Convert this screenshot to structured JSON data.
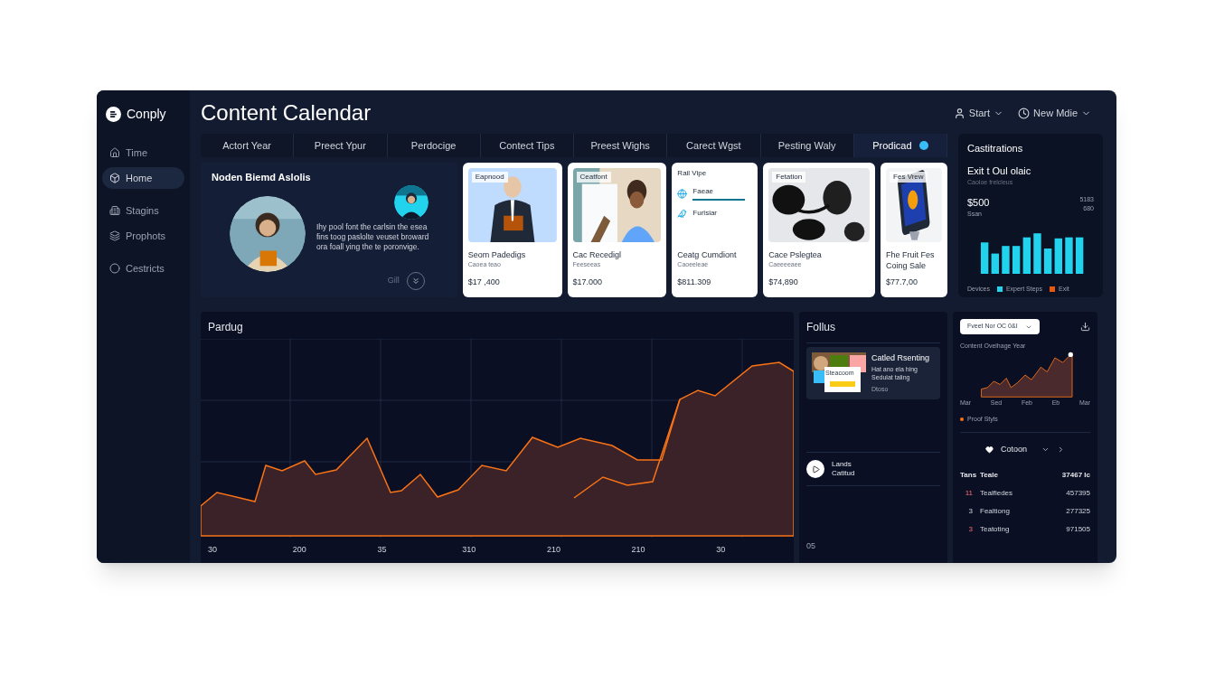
{
  "brand": {
    "name": "Conply"
  },
  "sidebar": {
    "items": [
      {
        "label": "Time",
        "selected": false
      },
      {
        "label": "Home",
        "selected": true
      },
      {
        "label": "Stagins",
        "selected": false
      },
      {
        "label": "Prophots",
        "selected": false
      },
      {
        "label": "Cestricts",
        "selected": false
      }
    ]
  },
  "header": {
    "title": "Content Calendar",
    "actions": [
      {
        "label": "Start"
      },
      {
        "label": "New Mdie"
      }
    ]
  },
  "tabs": [
    {
      "label": "Actort Year",
      "selected": false,
      "dot": false
    },
    {
      "label": "Preect Ypur",
      "selected": false,
      "dot": false
    },
    {
      "label": "Perdocige",
      "selected": false,
      "dot": false
    },
    {
      "label": "Contect Tips",
      "selected": false,
      "dot": false
    },
    {
      "label": "Preest Wighs",
      "selected": false,
      "dot": false
    },
    {
      "label": "Carect Wgst",
      "selected": false,
      "dot": false
    },
    {
      "label": "Pesting Waly",
      "selected": false,
      "dot": false
    },
    {
      "label": "Prodicad",
      "selected": true,
      "dot": true
    }
  ],
  "feature": {
    "title": "Noden Biemd Aslolis",
    "text": "Ihy pool font the carlsin the esea fins toog paslolte veuset broward ora foall ying the te poronvige.",
    "footer": "Gill"
  },
  "cards": [
    {
      "kind": "picture",
      "tag": "Eapnood",
      "title": "Seom Padedigs",
      "subtitle": "Caoea teao",
      "price": "$17 ,400"
    },
    {
      "kind": "picture",
      "tag": "Ceatfont",
      "title": "Cac Recedigl",
      "subtitle": "Feeseeas",
      "price": "$17.000"
    },
    {
      "kind": "list",
      "tag": "Rail Vipe",
      "items": [
        {
          "label": "Faeae"
        },
        {
          "label": "Furlsiar"
        }
      ],
      "title": "Ceatg Cumdiont",
      "subtitle": "Caoeeleae",
      "price": "$811.309"
    },
    {
      "kind": "picture",
      "tag": "Fetation",
      "title": "Cace Pslegtea",
      "subtitle": "Caeeeeaee",
      "price": "$74,890"
    },
    {
      "kind": "picture",
      "tag": "Fes Vrew",
      "title": "Fhe Fruit Fes Coing Sale",
      "price": "$77.7,00"
    }
  ],
  "stats": {
    "heading": "Castitrations",
    "title": "Exit t Oul olaic",
    "subtitle": "Caoloe frelcleus",
    "value": "$500",
    "value_note": "Ssan",
    "side_value": "5183",
    "side_note": "680",
    "legend": [
      {
        "label": "Devices"
      },
      {
        "label": "Expert Steps",
        "color": "#22d3ee"
      },
      {
        "label": "Exit",
        "color": "#ea580c"
      }
    ]
  },
  "trend": {
    "title": "Pardug",
    "x_labels": [
      "30",
      "200",
      "35",
      "310",
      "210",
      "210",
      "30"
    ]
  },
  "follow": {
    "title": "Follus",
    "post": {
      "title": "Catled Rsenting",
      "lines": "Hat ano ela hing Sedulat taling",
      "meta": "Dtoso",
      "badge": "Steacoom"
    },
    "play_label": "Lands Catitud",
    "footer": "05"
  },
  "insights": {
    "dropdown": "Fveet Nor OC 0&I",
    "chart_title": "Content Oveihage Year",
    "x_labels": [
      "Mar",
      "Sed",
      "Feb",
      "Eb",
      "Mar"
    ],
    "legend": "Proof Styls",
    "nav": "Cotoon",
    "table": {
      "header": [
        "Tans",
        "Teale",
        "37467 Ic"
      ],
      "rows": [
        {
          "rank": "11",
          "name": "Tealfiedes",
          "value": "457395"
        },
        {
          "rank": "3",
          "name": "Fealtiong",
          "value": "277325"
        },
        {
          "rank": "3",
          "name": "Teatoting",
          "value": "971505"
        }
      ]
    }
  }
}
